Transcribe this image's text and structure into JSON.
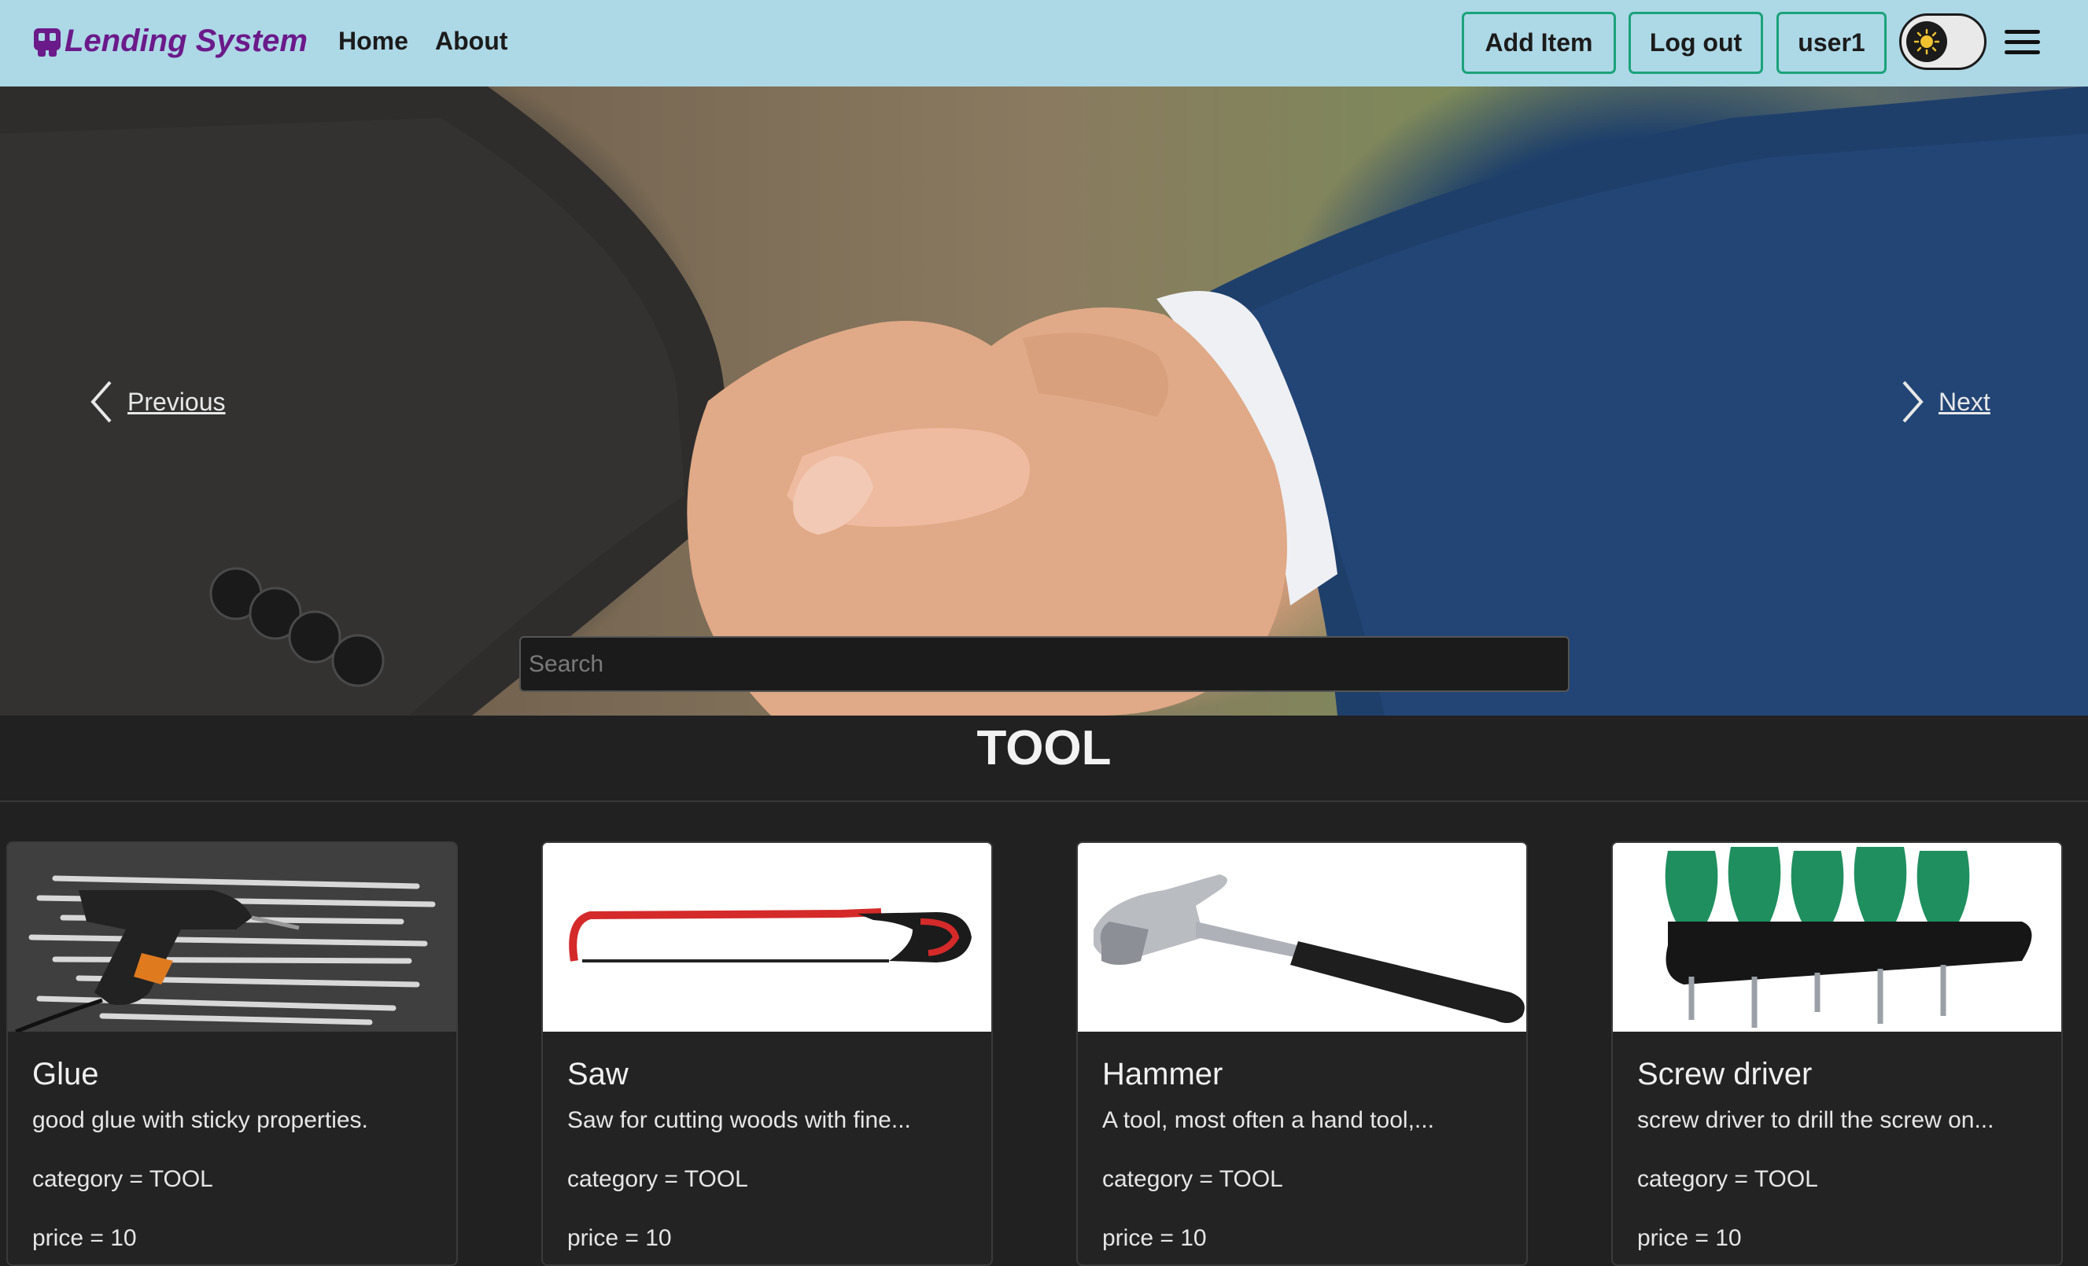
{
  "brand": {
    "name": "Lending System"
  },
  "nav": {
    "home": "Home",
    "about": "About"
  },
  "actions": {
    "add_item": "Add Item",
    "log_out": "Log out",
    "user": "user1"
  },
  "carousel": {
    "previous": "Previous",
    "next": "Next"
  },
  "search": {
    "placeholder": "Search"
  },
  "section": {
    "title": "TOOL"
  },
  "cards": [
    {
      "title": "Glue",
      "description": "good glue with sticky properties.",
      "category": "category = TOOL",
      "price": "price = 10"
    },
    {
      "title": "Saw",
      "description": "Saw for cutting woods with fine...",
      "category": "category = TOOL",
      "price": "price = 10"
    },
    {
      "title": "Hammer",
      "description": "A tool, most often a hand tool,...",
      "category": "category = TOOL",
      "price": "price = 10"
    },
    {
      "title": "Screw driver",
      "description": "screw driver to drill the screw on...",
      "category": "category = TOOL",
      "price": "price = 10"
    }
  ],
  "colors": {
    "navbar": "#add8e6",
    "brand": "#6b1a8a",
    "button_border": "#1aa37a",
    "page_bg": "#212121"
  }
}
